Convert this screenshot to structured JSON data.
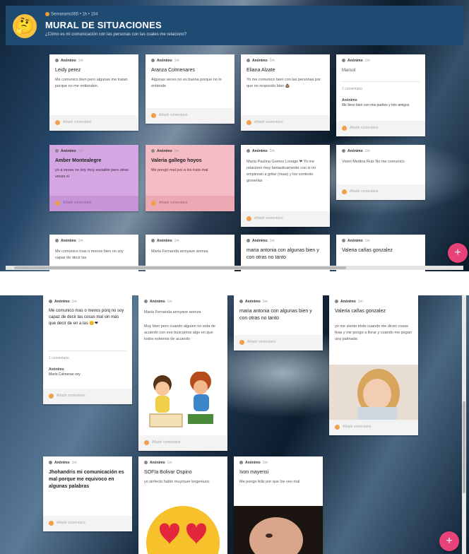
{
  "header": {
    "meta_author": "Semanario365",
    "meta_extra": "• 1h • 154",
    "title": "MURAL DE SITUACIONES",
    "subtitle": "¿Cómo es mi comunicación con las personas con las cuales me relaciono?",
    "avatar_icon": "thinking-face-emoji"
  },
  "common": {
    "author": "Anónimo",
    "time": "1m",
    "add_comment": "Añadir comentario"
  },
  "screen1_cards": [
    {
      "title": "Leidy perez",
      "body": "Me comunico bien pero algunas me tratan porque no me entienden."
    },
    {
      "title": "Aranza Colmenares",
      "body": "Algunas veces no es buena porque no lo entiende"
    },
    {
      "title": "Eliana Alzate",
      "body": "Yo me comunico bien con las personas por que no respondo bien 💩"
    },
    {
      "title": "Marisol",
      "body": "",
      "comment_count": "1 comentario",
      "comment_author": "Anónimo",
      "comment_text": "Me llevo bien con mis padres y mis amigos"
    },
    {
      "title": "Amber Montealegre",
      "body": "yo a veces no soy muy sociable pero otras veces si",
      "color": "purple"
    },
    {
      "title": "Valeria gallego hoyos",
      "body": "Me pongo mal por a los trato mal",
      "color": "pink"
    },
    {
      "title": "",
      "body": "María Paulina Gomez Loraigo ❤ Yo me relaciono muy fantasticamente con si mi empiezan a gritar (risas) y los contesto groserias"
    },
    {
      "title": "",
      "body": "Voleri Medina Ruiz No me comunico"
    },
    {
      "title": "",
      "body": "Me comunico mas o menos bien no soy capaz de decir las"
    },
    {
      "title": "",
      "body": "María Fernanda arroyave arenza"
    },
    {
      "title": "maria antonia con algunas bien y con otras no tanto",
      "body": ""
    },
    {
      "title": "Valeria cañas gonzalez",
      "body": ""
    }
  ],
  "screen2_cards": [
    {
      "title": "Me comunico mas o menos porq no soy capaz de decir las cosas mal sin más que decir de en a las 😊❤",
      "comment_count": "1 comentario",
      "comment_author": "Anónimo",
      "comment_text": "Mario Colmenar ovy"
    },
    {
      "title": "María Fernanda arroyave arenza",
      "body": "Muy bien pero cuando alguien no esta de acuerdo con eso buscamos algo en que todos estemos de acuerdo"
    },
    {
      "title": "maria antonia con algunas bien y con otras no tanto"
    },
    {
      "title": "Valeria cañas gonzalez",
      "body": "yo me siento triste cuando me dicen cosas feas y me pongo a llorar y cuando me pegan una palmada"
    },
    {
      "title": "Jhohandris mi comunicación es mal porque me equivoco en algunas palabras"
    },
    {
      "title": "SOFIa Bolivar Ospino",
      "body": "yo sinfecto hablo muymuer bogeniunc"
    },
    {
      "title": "Ivon mayensi",
      "body": "Me pongo feliz por que los veo mal"
    }
  ],
  "icons": {
    "fab": "plus-icon",
    "author": "user-icon",
    "comment": "comment-icon"
  },
  "colors": {
    "topbar": "#1f4b73",
    "fab": "#e8427a",
    "purple_card": "#d4a7e3",
    "pink_card": "#f6bcc6"
  }
}
